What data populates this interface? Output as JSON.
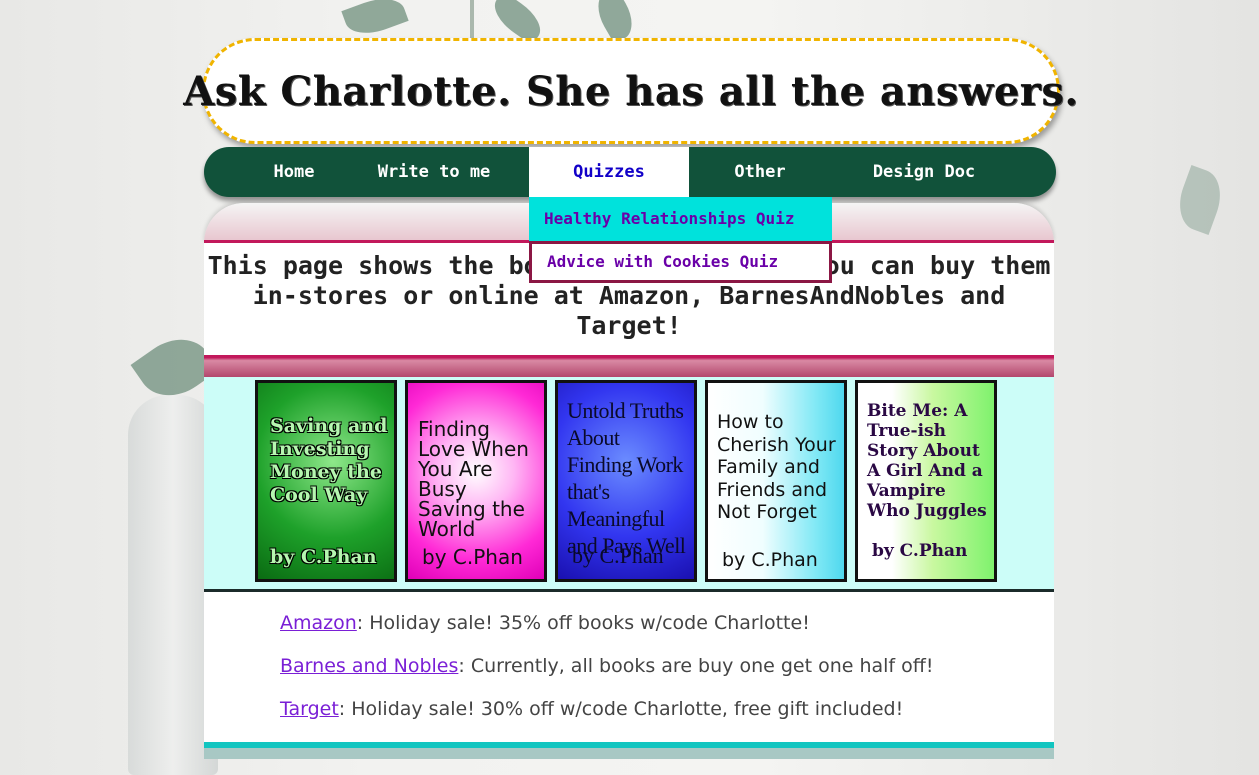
{
  "header": {
    "title": "Ask Charlotte. She has all the answers."
  },
  "nav": {
    "items": [
      {
        "label": "Home"
      },
      {
        "label": "Write to me"
      },
      {
        "label": "Quizzes"
      },
      {
        "label": "Other"
      },
      {
        "label": "Design Doc"
      }
    ],
    "active": "Quizzes",
    "dropdown": [
      {
        "label": "Healthy Relationships Quiz"
      },
      {
        "label": "Advice with Cookies Quiz"
      }
    ]
  },
  "intro": {
    "text": "This page shows the books I've written. You can buy them in-stores or online at Amazon, BarnesAndNobles and Target!"
  },
  "books": [
    {
      "title": "Saving and Investing Money the Cool Way",
      "author": "by C.Phan"
    },
    {
      "title": "Finding Love When You Are Busy Saving the World",
      "author": "by C.Phan"
    },
    {
      "title": "Untold Truths About Finding Work that's Meaningful and Pays Well",
      "author": "by C.Phan"
    },
    {
      "title": "How to Cherish Your Family and Friends and Not Forget",
      "author": "by C.Phan"
    },
    {
      "title": "Bite Me: A True-ish Story About A Girl And a Vampire Who Juggles",
      "author": "by C.Phan"
    }
  ],
  "sales": [
    {
      "store": "Amazon",
      "text": ": Holiday sale! 35% off books w/code Charlotte!"
    },
    {
      "store": "Barnes and Nobles",
      "text": ": Currently, all books are buy one get one half off!"
    },
    {
      "store": "Target",
      "text": ": Holiday sale! 30% off w/code Charlotte, free gift included!"
    }
  ],
  "colors": {
    "nav_bg": "#11523a",
    "accent_yellow": "#f0b400",
    "accent_pink": "#c2185b",
    "accent_teal": "#00e2dc",
    "link": "#7a1fd6"
  }
}
